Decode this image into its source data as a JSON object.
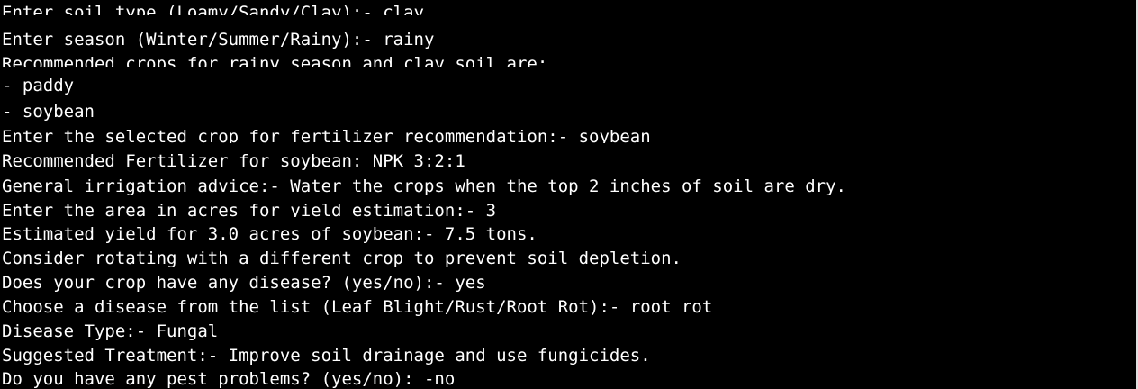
{
  "terminal": {
    "lines": [
      "Enter soil type (Loamy/Sandy/Clay):- clay",
      "Enter season (Winter/Summer/Rainy):- rainy",
      "Recommended crops for rainy season and clay soil are:",
      "- paddy",
      "- soybean",
      "Enter the selected crop for fertilizer recommendation:- soybean",
      "Recommended Fertilizer for soybean: NPK 3:2:1",
      "General irrigation advice:- Water the crops when the top 2 inches of soil are dry.",
      "Enter the area in acres for yield estimation:- 3",
      "Estimated yield for 3.0 acres of soybean:- 7.5 tons.",
      "Consider rotating with a different crop to prevent soil depletion.",
      "Does your crop have any disease? (yes/no):- yes",
      "Choose a disease from the list (Leaf Blight/Rust/Root Rot):- root rot",
      "Disease Type:- Fungal",
      "Suggested Treatment:- Improve soil drainage and use fungicides.",
      "Do you have any pest problems? (yes/no): -no"
    ]
  }
}
